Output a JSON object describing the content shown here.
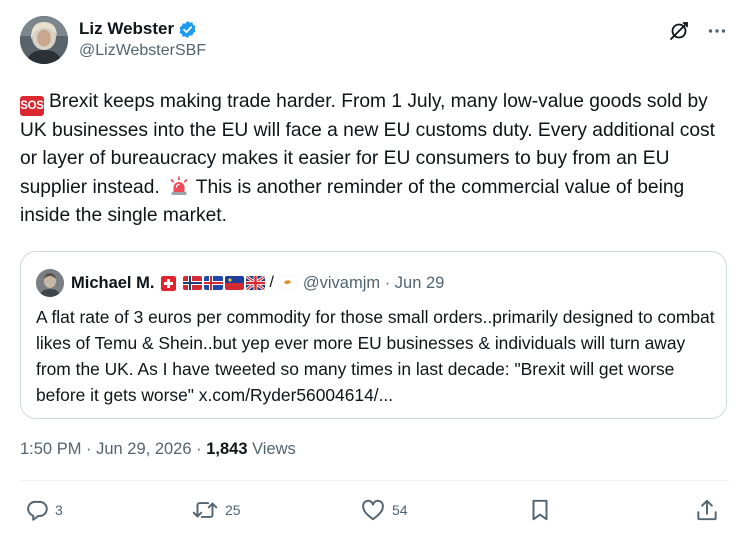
{
  "author": {
    "display_name": "Liz Webster",
    "handle": "@LizWebsterSBF"
  },
  "icons": {
    "verified": "verified-badge-icon",
    "grok": "grok-icon",
    "more": "more-icon",
    "reply": "reply-icon",
    "retweet": "retweet-icon",
    "like": "like-icon",
    "bookmark": "bookmark-icon",
    "share": "share-icon"
  },
  "tweet": {
    "sos_label": "SOS",
    "text_part1": "Brexit keeps making trade harder.  From 1 July, many low-value goods sold by UK businesses into the EU will face a new EU customs duty. Every additional cost or layer of bureaucracy makes it easier for EU consumers to buy from an EU supplier instead.",
    "text_part2": "This is another reminder of the commercial value of being inside the single market."
  },
  "quote": {
    "display_name": "Michael M.",
    "flag_separator": "/",
    "handle_date": "@vivamjm · Jun 29",
    "text": "A flat rate of 3 euros per commodity for those small orders..primarily designed to combat likes of Temu & Shein..but yep ever more EU businesses & individuals will turn away from the UK. As I have tweeted so many times in last decade: \"Brexit will get worse before it gets worse\" x.com/Ryder56004614/..."
  },
  "meta": {
    "timestamp": "1:50 PM · Jun 29, 2026 · ",
    "views_count": "1,843",
    "views_label": " Views"
  },
  "stats": {
    "replies": "3",
    "retweets": "25",
    "likes": "54"
  },
  "colors": {
    "verified_blue": "#1d9bf0",
    "sos_red": "#d9282f",
    "text_primary": "#0f1419",
    "text_secondary": "#536471",
    "border": "#cfd9de"
  }
}
